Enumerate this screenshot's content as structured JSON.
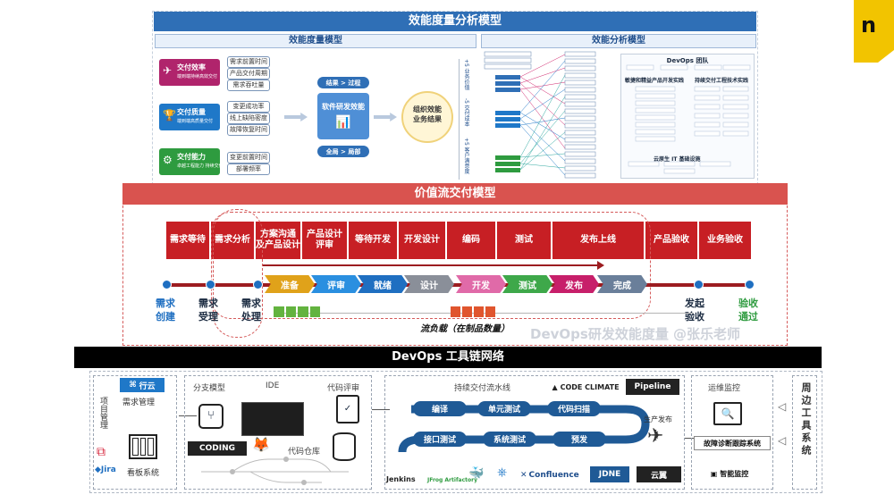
{
  "title_top": "效能度量分析模型",
  "left_model": {
    "title": "效能度量模型",
    "cards": [
      {
        "label": "交付效率",
        "sub": "端到端持续高效交付",
        "color": "#b0246c",
        "metrics": [
          "需求前置时间",
          "产品交付周期",
          "需求吞吐量"
        ]
      },
      {
        "label": "交付质量",
        "sub": "端到端高质量交付",
        "color": "#1f78c8",
        "metrics": [
          "变更成功率",
          "线上缺陷密度",
          "故障恢复时间"
        ]
      },
      {
        "label": "交付能力",
        "sub": "卓越工程能力 持续交付",
        "color": "#2e9b3f",
        "metrics": [
          "变更前置时间",
          "部署频率"
        ]
      }
    ],
    "center": {
      "top": "结果 > 过程",
      "main": "软件研发效能",
      "bottom": "全局 > 局部"
    },
    "circle": "组织效能\n业务结果",
    "side": [
      "+5 业务价值",
      "-5 交付成本",
      "+5 客户满意度"
    ]
  },
  "right_model": {
    "title": "效能分析模型",
    "devops_team": "DevOps 团队",
    "agile": "敏捷和精益产品开发实践",
    "ci": "持续交付工程技术实践",
    "cloud": "云原生 IT 基础设施"
  },
  "value_stream": {
    "title": "价值流交付模型",
    "headers": [
      "需求等待",
      "需求分析",
      "方案沟通\n及产品设计",
      "产品设计\n评审",
      "等待开发",
      "开发设计",
      "编码",
      "测试",
      "发布上线",
      "产品验收",
      "业务验收"
    ],
    "stages": [
      "准备",
      "评审",
      "就绪",
      "设计",
      "开发",
      "测试",
      "发布",
      "完成"
    ],
    "stage_colors": [
      "#e0a21a",
      "#2a8fe0",
      "#1f6fc1",
      "#8a8f99",
      "#e06aa8",
      "#3ea84a",
      "#c71f6a",
      "#6a7f9a"
    ],
    "milestones": [
      {
        "l1": "需求",
        "l2": "创建",
        "color": "#1f6fc1"
      },
      {
        "l1": "需求",
        "l2": "受理",
        "color": "#1a2a40"
      },
      {
        "l1": "需求",
        "l2": "处理",
        "color": "#1a2a40"
      },
      {
        "l1": "发起",
        "l2": "验收",
        "color": "#1a2a40"
      },
      {
        "l1": "验收",
        "l2": "通过",
        "color": "#2e9b3f"
      }
    ],
    "flow_label": "流负载（在制品数量）",
    "watermark": "DevOps研发效能度量 @张乐老师"
  },
  "toolchain": {
    "title": "DevOps 工具链网络",
    "project_mgmt": "项目管理",
    "xingyun": "行云",
    "req_mgmt": "需求管理",
    "kanban": "看板系统",
    "jira": "Jira",
    "branch_model": "分支模型",
    "ide": "IDE",
    "code_review": "代码评审",
    "coding": "CODING",
    "repo": "代码仓库",
    "ci_pipeline": "持续交付流水线",
    "code_climate": "CODE CLIMATE",
    "pipeline": "Pipeline",
    "ci_nodes": [
      "编译",
      "单元测试",
      "代码扫描",
      "接口测试",
      "系统测试",
      "预发"
    ],
    "prod_release": "生产发布",
    "ops": "运维监控",
    "fault": "故障诊断跟踪系统",
    "smart": "智能监控",
    "periph": "周边工具系统",
    "tools": [
      "Jenkins",
      "JFrog Artifactory",
      "Confluence",
      "JDNE",
      "云翼"
    ]
  }
}
